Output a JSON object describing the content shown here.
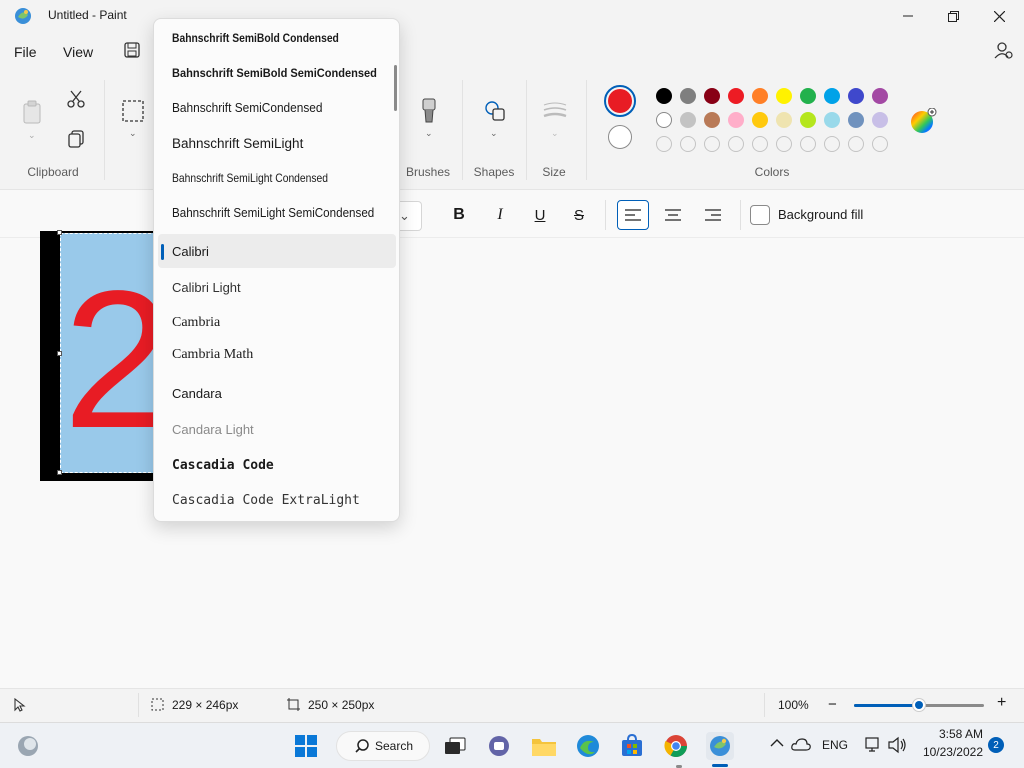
{
  "window": {
    "title": "Untitled - Paint"
  },
  "menu": {
    "file": "File",
    "view": "View"
  },
  "ribbon": {
    "groups": {
      "clipboard": "Clipboard",
      "brushes": "Brushes",
      "shapes": "Shapes",
      "size": "Size",
      "colors": "Colors"
    },
    "primary_color": "#e81c24",
    "secondary_color": "#ffffff",
    "palette_row1": [
      "#000000",
      "#7f7f7f",
      "#880015",
      "#ed1c24",
      "#ff7f27",
      "#fff200",
      "#22b14c",
      "#00a2e8",
      "#3f48cc",
      "#a349a4"
    ],
    "palette_row2": [
      "#ffffff",
      "#c3c3c3",
      "#b97a57",
      "#ffaec9",
      "#ffc90e",
      "#efe4b0",
      "#b5e61d",
      "#99d9ea",
      "#7092be",
      "#c8bfe7"
    ]
  },
  "text_toolbar": {
    "bold": "B",
    "italic": "I",
    "underline": "U",
    "strikethrough": "S",
    "background_fill": "Background fill"
  },
  "canvas": {
    "glyph": "2",
    "glyph_color": "#e81c24",
    "fill_color": "#99c9ea"
  },
  "font_dropdown": {
    "items": [
      "Bahnschrift SemiBold Condensed",
      "Bahnschrift SemiBold SemiCondensed",
      "Bahnschrift SemiCondensed",
      "Bahnschrift SemiLight",
      "Bahnschrift SemiLight Condensed",
      "Bahnschrift SemiLight SemiCondensed",
      "Calibri",
      "Calibri Light",
      "Cambria",
      "Cambria Math",
      "Candara",
      "Candara Light",
      "Cascadia Code",
      "Cascadia Code ExtraLight"
    ],
    "selected": "Calibri"
  },
  "status": {
    "selection_size": "229 × 246px",
    "canvas_size": "250 × 250px",
    "zoom": "100%",
    "zoom_level": 0.5
  },
  "taskbar": {
    "search_label": "Search",
    "language": "ENG",
    "time": "3:58 AM",
    "date": "10/23/2022",
    "notification_count": "2"
  }
}
